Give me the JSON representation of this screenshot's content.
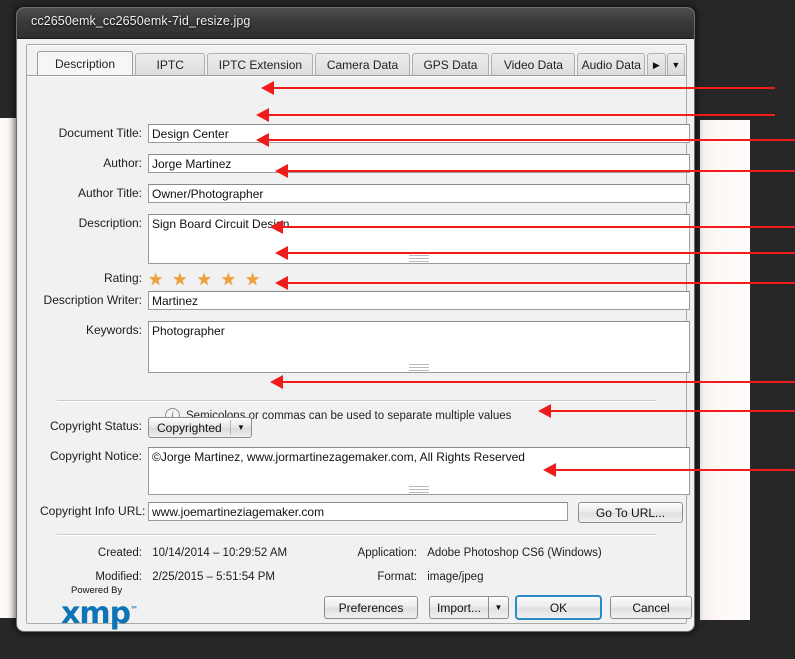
{
  "window": {
    "title": "cc2650emk_cc2650emk-7id_resize.jpg"
  },
  "tabs": [
    {
      "label": "Description",
      "active": true
    },
    {
      "label": "IPTC",
      "active": false
    },
    {
      "label": "IPTC Extension",
      "active": false
    },
    {
      "label": "Camera Data",
      "active": false
    },
    {
      "label": "GPS Data",
      "active": false
    },
    {
      "label": "Video Data",
      "active": false
    },
    {
      "label": "Audio Data",
      "active": false
    }
  ],
  "tab_nav": {
    "next_icon": "▶",
    "menu_icon": "▼"
  },
  "fields": {
    "document_title": {
      "label": "Document Title:",
      "value": "Design Center"
    },
    "author": {
      "label": "Author:",
      "value": "Jorge Martinez"
    },
    "author_title": {
      "label": "Author Title:",
      "value": "Owner/Photographer"
    },
    "description": {
      "label": "Description:",
      "value": "Sign Board Circuit Design"
    },
    "rating": {
      "label": "Rating:",
      "value": 5,
      "max": 5,
      "star_glyph": "★",
      "star_color": "#eda13c"
    },
    "description_writer": {
      "label": "Description Writer:",
      "value": "Martinez"
    },
    "keywords": {
      "label": "Keywords:",
      "value": "Photographer"
    },
    "copyright_status": {
      "label": "Copyright Status:",
      "value": "Copyrighted",
      "arrow_icon": "▼"
    },
    "copyright_notice": {
      "label": "Copyright Notice:",
      "value": "©Jorge Martinez, www.jormartinezagemaker.com, All Rights Reserved"
    },
    "copyright_info_url": {
      "label": "Copyright Info URL:",
      "value": "www.joemartineziagemaker.com"
    }
  },
  "hint": {
    "icon": "i",
    "text": "Semicolons or commas can be used to separate multiple values"
  },
  "go_to_url_button": {
    "label": "Go To URL..."
  },
  "metadata": {
    "created": {
      "label": "Created:",
      "value": "10/14/2014 – 10:29:52 AM"
    },
    "modified": {
      "label": "Modified:",
      "value": "2/25/2015 – 5:51:54 PM"
    },
    "application": {
      "label": "Application:",
      "value": "Adobe Photoshop CS6 (Windows)"
    },
    "format": {
      "label": "Format:",
      "value": "image/jpeg"
    }
  },
  "logo": {
    "powered_by": "Powered By",
    "wordmark": "xmp",
    "trademark": "™"
  },
  "buttons": {
    "preferences": "Preferences",
    "import": "Import...",
    "import_arrow": "▼",
    "ok": "OK",
    "cancel": "Cancel"
  },
  "colors": {
    "annotation": "#ee1c1c",
    "primary_border": "#2e8bc6",
    "star": "#eda13c"
  }
}
